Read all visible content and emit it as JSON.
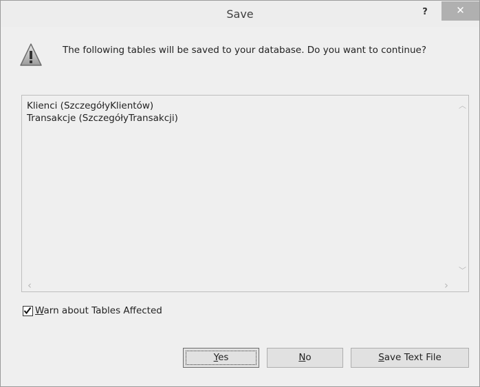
{
  "window": {
    "title": "Save",
    "help_label": "?",
    "close_label": "✕"
  },
  "message": "The following tables will be saved to your database. Do you want to continue?",
  "tables": [
    "Klienci (SzczegółyKlientów)",
    "Transakcje (SzczegółyTransakcji)"
  ],
  "scroll_arrows": {
    "up": "︿",
    "down": "﹀",
    "left": "‹",
    "right": "›"
  },
  "warn_checkbox": {
    "checked": true,
    "mnemonic": "W",
    "label_rest": "arn about Tables Affected"
  },
  "buttons": {
    "yes": {
      "mnemonic": "Y",
      "rest": "es"
    },
    "no": {
      "mnemonic": "N",
      "rest": "o"
    },
    "save_text_file": {
      "mnemonic": "S",
      "rest": "ave Text File"
    }
  },
  "icons": {
    "warning": "warning-icon"
  }
}
